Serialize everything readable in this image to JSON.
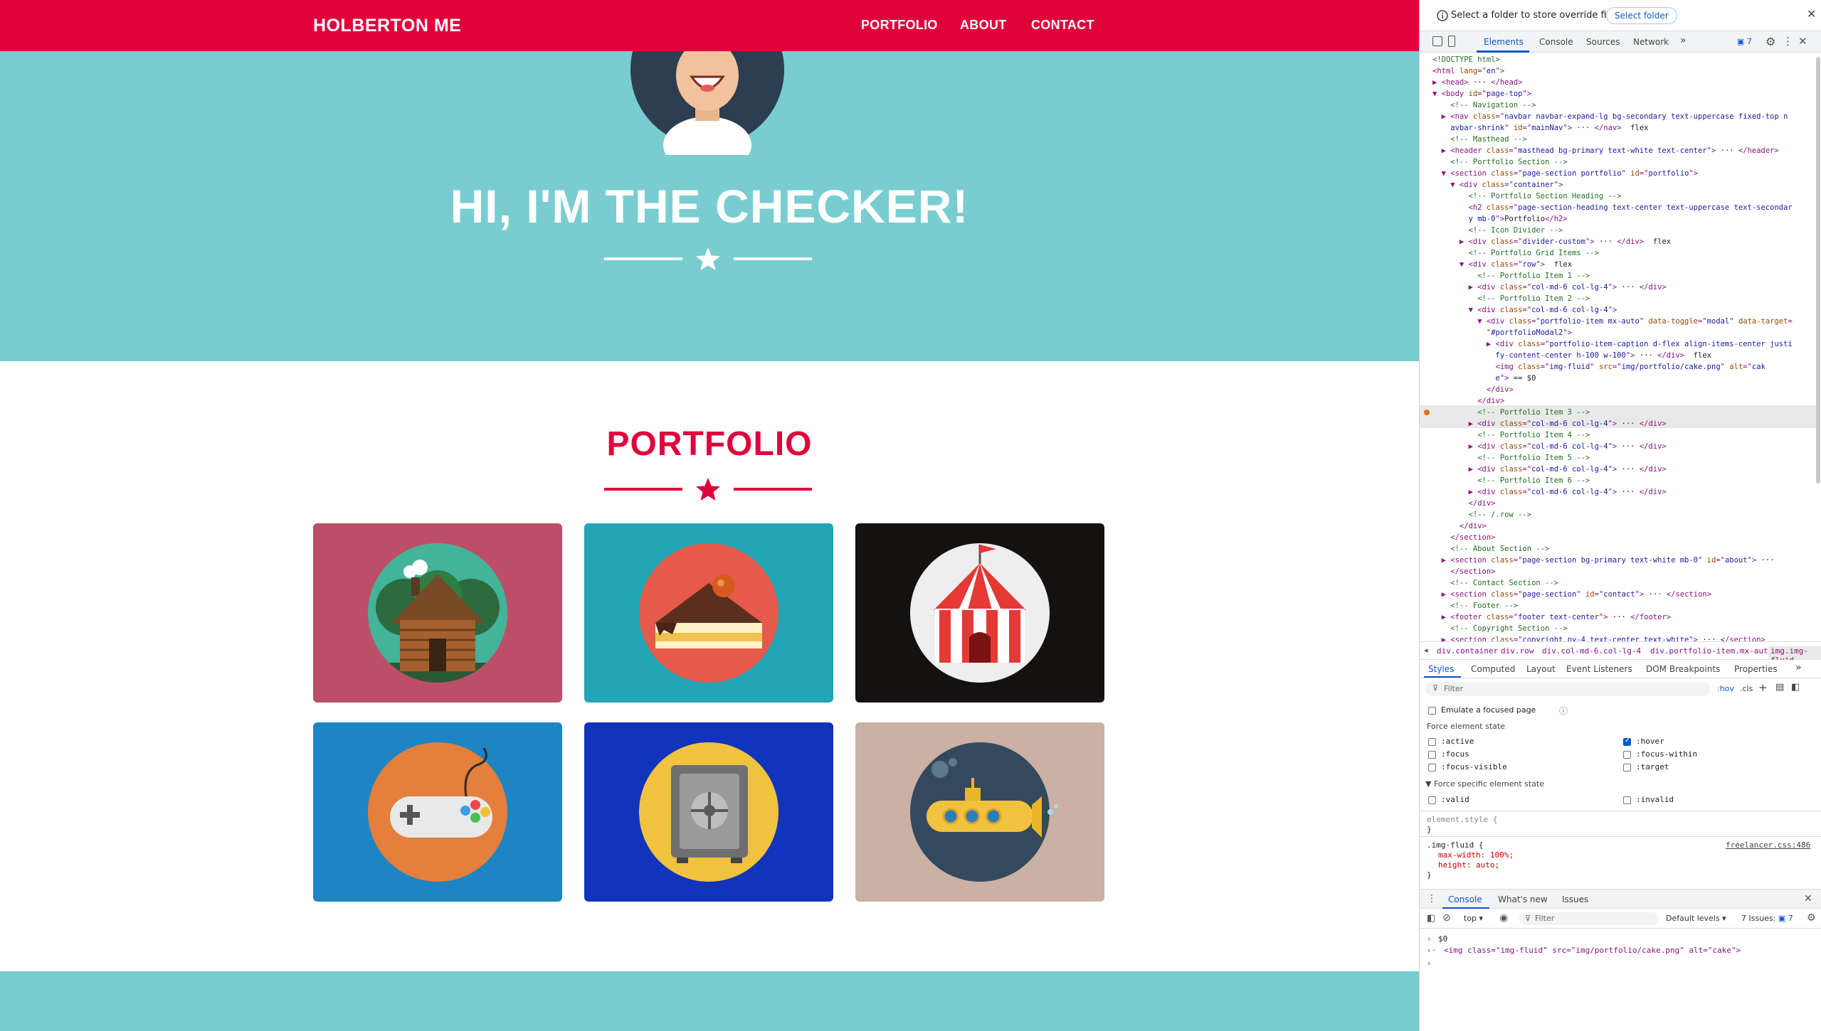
{
  "site": {
    "brand": "HOLBERTON ME",
    "nav": [
      "PORTFOLIO",
      "ABOUT",
      "CONTACT"
    ],
    "hero_title": "HI, I'M THE CHECKER!",
    "portfolio_title": "PORTFOLIO",
    "tiles": [
      {
        "name": "cabin",
        "alt": "cabin",
        "bg": "#bc4f67"
      },
      {
        "name": "cake",
        "alt": "cake",
        "bg": "#22a5b5"
      },
      {
        "name": "circus",
        "alt": "circus",
        "bg": "#141111"
      },
      {
        "name": "game",
        "alt": "game",
        "bg": "#1f84c4"
      },
      {
        "name": "safe",
        "alt": "safe",
        "bg": "#1134ba"
      },
      {
        "name": "submarine",
        "alt": "submarine",
        "bg": "#cab1a3"
      }
    ],
    "colors": {
      "primary": "#e0003c",
      "secondary": "#79cdd1"
    }
  },
  "devtools": {
    "info_text": "Select a folder to store override files in.",
    "select_folder": "Select folder",
    "tabs": [
      "Elements",
      "Console",
      "Sources",
      "Network"
    ],
    "more_tabs": "»",
    "issues_count": "7",
    "dom_lines": [
      [
        {
          "c": "cm",
          "t": "<!DOCTYPE html>"
        }
      ],
      [
        {
          "c": "tg",
          "t": "<html "
        },
        {
          "c": "at",
          "t": "lang"
        },
        {
          "c": "tg",
          "t": "=\""
        },
        {
          "c": "av",
          "t": "en"
        },
        {
          "c": "tg",
          "t": "\">"
        }
      ],
      [
        {
          "c": "tg",
          "t": "▶ <head>"
        },
        {
          "c": "tx",
          "t": " ··· "
        },
        {
          "c": "tg",
          "t": "</head>"
        }
      ],
      [
        {
          "c": "tg",
          "t": "▼ <body "
        },
        {
          "c": "at",
          "t": "id"
        },
        {
          "c": "tg",
          "t": "=\""
        },
        {
          "c": "av",
          "t": "page-top"
        },
        {
          "c": "tg",
          "t": "\">"
        }
      ],
      [
        {
          "c": "cm",
          "t": "    <!-- Navigation -->"
        }
      ],
      [
        {
          "c": "tg",
          "t": "  ▶ <nav "
        },
        {
          "c": "at",
          "t": "class"
        },
        {
          "c": "tg",
          "t": "=\""
        },
        {
          "c": "av",
          "t": "navbar navbar-expand-lg bg-secondary text-uppercase fixed-top n"
        }
      ],
      [
        {
          "c": "av",
          "t": "    avbar-shrink"
        },
        {
          "c": "tg",
          "t": "\" "
        },
        {
          "c": "at",
          "t": "id"
        },
        {
          "c": "tg",
          "t": "=\""
        },
        {
          "c": "av",
          "t": "mainNav"
        },
        {
          "c": "tg",
          "t": "\">"
        },
        {
          "c": "tx",
          "t": " ··· "
        },
        {
          "c": "tg",
          "t": "</nav>"
        },
        {
          "c": "tx",
          "t": "  flex"
        }
      ],
      [
        {
          "c": "cm",
          "t": "    <!-- Masthead -->"
        }
      ],
      [
        {
          "c": "tg",
          "t": "  ▶ <header "
        },
        {
          "c": "at",
          "t": "class"
        },
        {
          "c": "tg",
          "t": "=\""
        },
        {
          "c": "av",
          "t": "masthead bg-primary text-white text-center"
        },
        {
          "c": "tg",
          "t": "\">"
        },
        {
          "c": "tx",
          "t": " ··· "
        },
        {
          "c": "tg",
          "t": "</header>"
        }
      ],
      [
        {
          "c": "cm",
          "t": "    <!-- Portfolio Section -->"
        }
      ],
      [
        {
          "c": "tg",
          "t": "  ▼ <section "
        },
        {
          "c": "at",
          "t": "class"
        },
        {
          "c": "tg",
          "t": "=\""
        },
        {
          "c": "av",
          "t": "page-section portfolio"
        },
        {
          "c": "tg",
          "t": "\" "
        },
        {
          "c": "at",
          "t": "id"
        },
        {
          "c": "tg",
          "t": "=\""
        },
        {
          "c": "av",
          "t": "portfolio"
        },
        {
          "c": "tg",
          "t": "\">"
        }
      ],
      [
        {
          "c": "tg",
          "t": "    ▼ <div "
        },
        {
          "c": "at",
          "t": "class"
        },
        {
          "c": "tg",
          "t": "=\""
        },
        {
          "c": "av",
          "t": "container"
        },
        {
          "c": "tg",
          "t": "\">"
        }
      ],
      [
        {
          "c": "cm",
          "t": "        <!-- Portfolio Section Heading -->"
        }
      ],
      [
        {
          "c": "tg",
          "t": "        <h2 "
        },
        {
          "c": "at",
          "t": "class"
        },
        {
          "c": "tg",
          "t": "=\""
        },
        {
          "c": "av",
          "t": "page-section-heading text-center text-uppercase text-secondar"
        }
      ],
      [
        {
          "c": "av",
          "t": "        y mb-0"
        },
        {
          "c": "tg",
          "t": "\">"
        },
        {
          "c": "tx",
          "t": "Portfolio"
        },
        {
          "c": "tg",
          "t": "</h2>"
        }
      ],
      [
        {
          "c": "cm",
          "t": "        <!-- Icon Divider -->"
        }
      ],
      [
        {
          "c": "tg",
          "t": "      ▶ <div "
        },
        {
          "c": "at",
          "t": "class"
        },
        {
          "c": "tg",
          "t": "=\""
        },
        {
          "c": "av",
          "t": "divider-custom"
        },
        {
          "c": "tg",
          "t": "\">"
        },
        {
          "c": "tx",
          "t": " ··· "
        },
        {
          "c": "tg",
          "t": "</div>"
        },
        {
          "c": "tx",
          "t": "  flex"
        }
      ],
      [
        {
          "c": "cm",
          "t": "        <!-- Portfolio Grid Items -->"
        }
      ],
      [
        {
          "c": "tg",
          "t": "      ▼ <div "
        },
        {
          "c": "at",
          "t": "class"
        },
        {
          "c": "tg",
          "t": "=\""
        },
        {
          "c": "av",
          "t": "row"
        },
        {
          "c": "tg",
          "t": "\">"
        },
        {
          "c": "tx",
          "t": "  flex"
        }
      ],
      [
        {
          "c": "cm",
          "t": "          <!-- Portfolio Item 1 -->"
        }
      ],
      [
        {
          "c": "tg",
          "t": "        ▶ <div "
        },
        {
          "c": "at",
          "t": "class"
        },
        {
          "c": "tg",
          "t": "=\""
        },
        {
          "c": "av",
          "t": "col-md-6 col-lg-4"
        },
        {
          "c": "tg",
          "t": "\">"
        },
        {
          "c": "tx",
          "t": " ··· "
        },
        {
          "c": "tg",
          "t": "</div>"
        }
      ],
      [
        {
          "c": "cm",
          "t": "          <!-- Portfolio Item 2 -->"
        }
      ],
      [
        {
          "c": "tg",
          "t": "        ▼ <div "
        },
        {
          "c": "at",
          "t": "class"
        },
        {
          "c": "tg",
          "t": "=\""
        },
        {
          "c": "av",
          "t": "col-md-6 col-lg-4"
        },
        {
          "c": "tg",
          "t": "\">"
        }
      ],
      [
        {
          "c": "tg",
          "t": "          ▼ <div "
        },
        {
          "c": "at",
          "t": "class"
        },
        {
          "c": "tg",
          "t": "=\""
        },
        {
          "c": "av",
          "t": "portfolio-item mx-auto"
        },
        {
          "c": "tg",
          "t": "\" "
        },
        {
          "c": "at",
          "t": "data-toggle"
        },
        {
          "c": "tg",
          "t": "=\""
        },
        {
          "c": "av",
          "t": "modal"
        },
        {
          "c": "tg",
          "t": "\" "
        },
        {
          "c": "at",
          "t": "data-target"
        },
        {
          "c": "tg",
          "t": "="
        }
      ],
      [
        {
          "c": "tg",
          "t": "            \""
        },
        {
          "c": "av",
          "t": "#portfolioModal2"
        },
        {
          "c": "tg",
          "t": "\">"
        }
      ],
      [
        {
          "c": "tg",
          "t": "            ▶ <div "
        },
        {
          "c": "at",
          "t": "class"
        },
        {
          "c": "tg",
          "t": "=\""
        },
        {
          "c": "av",
          "t": "portfolio-item-caption d-flex align-items-center justi"
        }
      ],
      [
        {
          "c": "av",
          "t": "              fy-content-center h-100 w-100"
        },
        {
          "c": "tg",
          "t": "\">"
        },
        {
          "c": "tx",
          "t": " ··· "
        },
        {
          "c": "tg",
          "t": "</div>"
        },
        {
          "c": "tx",
          "t": "  flex"
        }
      ],
      [
        {
          "c": "tg",
          "t": "              <img "
        },
        {
          "c": "at",
          "t": "class"
        },
        {
          "c": "tg",
          "t": "=\""
        },
        {
          "c": "av",
          "t": "img-fluid"
        },
        {
          "c": "tg",
          "t": "\" "
        },
        {
          "c": "at",
          "t": "src"
        },
        {
          "c": "tg",
          "t": "=\""
        },
        {
          "c": "av",
          "t": "img/portfolio/cake.png"
        },
        {
          "c": "tg",
          "t": "\" "
        },
        {
          "c": "at",
          "t": "alt"
        },
        {
          "c": "tg",
          "t": "=\""
        },
        {
          "c": "av",
          "t": "cak"
        }
      ],
      [
        {
          "c": "av",
          "t": "              e"
        },
        {
          "c": "tg",
          "t": "\">"
        },
        {
          "c": "tx",
          "t": " == $0"
        }
      ],
      [
        {
          "c": "tg",
          "t": "            </div>"
        }
      ],
      [
        {
          "c": "tg",
          "t": "          </div>"
        }
      ],
      [
        {
          "c": "cm",
          "t": "          <!-- Portfolio Item 3 -->"
        }
      ],
      [
        {
          "c": "tg",
          "t": "        ▶ <div "
        },
        {
          "c": "at",
          "t": "class"
        },
        {
          "c": "tg",
          "t": "=\""
        },
        {
          "c": "av",
          "t": "col-md-6 col-lg-4"
        },
        {
          "c": "tg",
          "t": "\">"
        },
        {
          "c": "tx",
          "t": " ··· "
        },
        {
          "c": "tg",
          "t": "</div>"
        }
      ],
      [
        {
          "c": "cm",
          "t": "          <!-- Portfolio Item 4 -->"
        }
      ],
      [
        {
          "c": "tg",
          "t": "        ▶ <div "
        },
        {
          "c": "at",
          "t": "class"
        },
        {
          "c": "tg",
          "t": "=\""
        },
        {
          "c": "av",
          "t": "col-md-6 col-lg-4"
        },
        {
          "c": "tg",
          "t": "\">"
        },
        {
          "c": "tx",
          "t": " ··· "
        },
        {
          "c": "tg",
          "t": "</div>"
        }
      ],
      [
        {
          "c": "cm",
          "t": "          <!-- Portfolio Item 5 -->"
        }
      ],
      [
        {
          "c": "tg",
          "t": "        ▶ <div "
        },
        {
          "c": "at",
          "t": "class"
        },
        {
          "c": "tg",
          "t": "=\""
        },
        {
          "c": "av",
          "t": "col-md-6 col-lg-4"
        },
        {
          "c": "tg",
          "t": "\">"
        },
        {
          "c": "tx",
          "t": " ··· "
        },
        {
          "c": "tg",
          "t": "</div>"
        }
      ],
      [
        {
          "c": "cm",
          "t": "          <!-- Portfolio Item 6 -->"
        }
      ],
      [
        {
          "c": "tg",
          "t": "        ▶ <div "
        },
        {
          "c": "at",
          "t": "class"
        },
        {
          "c": "tg",
          "t": "=\""
        },
        {
          "c": "av",
          "t": "col-md-6 col-lg-4"
        },
        {
          "c": "tg",
          "t": "\">"
        },
        {
          "c": "tx",
          "t": " ··· "
        },
        {
          "c": "tg",
          "t": "</div>"
        }
      ],
      [
        {
          "c": "tg",
          "t": "        </div>"
        }
      ],
      [
        {
          "c": "cm",
          "t": "        <!-- /.row -->"
        }
      ],
      [
        {
          "c": "tg",
          "t": "      </div>"
        }
      ],
      [
        {
          "c": "tg",
          "t": "    </section>"
        }
      ],
      [
        {
          "c": "cm",
          "t": "    <!-- About Section -->"
        }
      ],
      [
        {
          "c": "tg",
          "t": "  ▶ <section "
        },
        {
          "c": "at",
          "t": "class"
        },
        {
          "c": "tg",
          "t": "=\""
        },
        {
          "c": "av",
          "t": "page-section bg-primary text-white mb-0"
        },
        {
          "c": "tg",
          "t": "\" "
        },
        {
          "c": "at",
          "t": "id"
        },
        {
          "c": "tg",
          "t": "=\""
        },
        {
          "c": "av",
          "t": "about"
        },
        {
          "c": "tg",
          "t": "\">"
        },
        {
          "c": "tx",
          "t": " ··· "
        }
      ],
      [
        {
          "c": "tg",
          "t": "    </section>"
        }
      ],
      [
        {
          "c": "cm",
          "t": "    <!-- Contact Section -->"
        }
      ],
      [
        {
          "c": "tg",
          "t": "  ▶ <section "
        },
        {
          "c": "at",
          "t": "class"
        },
        {
          "c": "tg",
          "t": "=\""
        },
        {
          "c": "av",
          "t": "page-section"
        },
        {
          "c": "tg",
          "t": "\" "
        },
        {
          "c": "at",
          "t": "id"
        },
        {
          "c": "tg",
          "t": "=\""
        },
        {
          "c": "av",
          "t": "contact"
        },
        {
          "c": "tg",
          "t": "\">"
        },
        {
          "c": "tx",
          "t": " ··· "
        },
        {
          "c": "tg",
          "t": "</section>"
        }
      ],
      [
        {
          "c": "cm",
          "t": "    <!-- Footer -->"
        }
      ],
      [
        {
          "c": "tg",
          "t": "  ▶ <footer "
        },
        {
          "c": "at",
          "t": "class"
        },
        {
          "c": "tg",
          "t": "=\""
        },
        {
          "c": "av",
          "t": "footer text-center"
        },
        {
          "c": "tg",
          "t": "\">"
        },
        {
          "c": "tx",
          "t": " ··· "
        },
        {
          "c": "tg",
          "t": "</footer>"
        }
      ],
      [
        {
          "c": "cm",
          "t": "    <!-- Copyright Section -->"
        }
      ],
      [
        {
          "c": "tg",
          "t": "  ▶ <section "
        },
        {
          "c": "at",
          "t": "class"
        },
        {
          "c": "tg",
          "t": "=\""
        },
        {
          "c": "av",
          "t": "copyright py-4 text-center text-white"
        },
        {
          "c": "tg",
          "t": "\">"
        },
        {
          "c": "tx",
          "t": " ··· "
        },
        {
          "c": "tg",
          "t": "</section>"
        }
      ]
    ],
    "breadcrumbs": [
      "div.container",
      "div.row",
      "div.col-md-6.col-lg-4",
      "div.portfolio-item.mx-auto",
      "img.img-fluid"
    ],
    "subtabs": [
      "Styles",
      "Computed",
      "Layout",
      "Event Listeners",
      "DOM Breakpoints",
      "Properties"
    ],
    "filter_placeholder": "Filter",
    "hov": ":hov",
    "cls": ".cls",
    "emulate_focus": "Emulate a focused page",
    "force_state_title": "Force element state",
    "states_left": [
      ":active",
      ":focus",
      ":focus-visible"
    ],
    "states_right": [
      ":hover",
      ":focus-within",
      ":target"
    ],
    "hover_checked": true,
    "force_specific_title": "Force specific element state",
    "specific_left": ":valid",
    "specific_right": ":invalid",
    "element_style": "element.style {",
    "close_brace": "}",
    "rule_selector": ".img-fluid {",
    "rule_source": "freelancer.css:486",
    "rule_props": [
      "max-width: 100%;",
      "height: auto;"
    ],
    "console_tabs": [
      "Console",
      "What's new",
      "Issues"
    ],
    "console_context": "top",
    "console_filter": "Filter",
    "default_levels": "Default levels",
    "issues_label": "7 Issues:",
    "console_lines": [
      "$0",
      "<img class=\"img-fluid\" src=\"img/portfolio/cake.png\" alt=\"cake\">"
    ]
  }
}
